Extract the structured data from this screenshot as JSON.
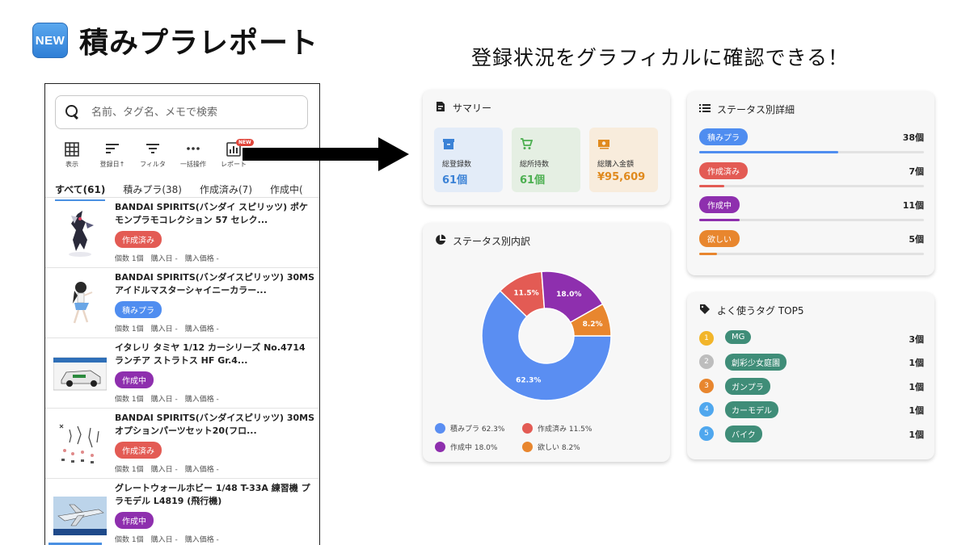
{
  "header": {
    "new_badge": "NEW",
    "title": "積みプラレポート",
    "tagline": "登録状況をグラフィカルに確認できる！"
  },
  "phone": {
    "search_placeholder": "名前、タグ名、メモで検索",
    "toolbar": [
      {
        "label": "表示",
        "icon": "grid-icon"
      },
      {
        "label": "登録日↑",
        "icon": "sort-icon"
      },
      {
        "label": "フィルタ",
        "icon": "filter-icon"
      },
      {
        "label": "一括操作",
        "icon": "more-icon"
      },
      {
        "label": "レポート",
        "icon": "report-icon",
        "badge": "NEW"
      }
    ],
    "tabs": [
      "すべて(61)",
      "積みプラ(38)",
      "作成済み(7)",
      "作成中("
    ],
    "items": [
      {
        "title": "BANDAI SPIRITS(バンダイ スピリッツ) ポケモンプラモコレクション 57 セレク...",
        "status": "作成済み",
        "status_color": "#e35b54",
        "meta": "個数 1個　購入日 -　購入価格 -"
      },
      {
        "title": "BANDAI SPIRITS(バンダイスピリッツ) 30MS アイドルマスターシャイニーカラー...",
        "status": "積みプラ",
        "status_color": "#4f8df0",
        "meta": "個数 1個　購入日 -　購入価格 -"
      },
      {
        "title": "イタレリ タミヤ 1/12 カーシリーズ No.4714 ランチア ストラトス HF Gr.4...",
        "status": "作成中",
        "status_color": "#8e2fae",
        "meta": "個数 1個　購入日 -　購入価格 -"
      },
      {
        "title": "BANDAI SPIRITS(バンダイスピリッツ) 30MS オプションパーツセット20(フロ...",
        "status": "作成済み",
        "status_color": "#e35b54",
        "meta": "個数 1個　購入日 -　購入価格 -"
      },
      {
        "title": "グレートウォールホビー 1/48 T-33A 練習機 プラモデル L4819 (飛行機)",
        "status": "作成中",
        "status_color": "#8e2fae",
        "meta": "個数 1個　購入日 -　購入価格 -"
      }
    ]
  },
  "summary": {
    "title": "サマリー",
    "boxes": [
      {
        "label": "総登録数",
        "value": "61個",
        "bg": "#e3ecf8",
        "color": "#3b82d6",
        "icon": "archive-icon"
      },
      {
        "label": "総所持数",
        "value": "61個",
        "bg": "#e5efe3",
        "color": "#4caf50",
        "icon": "cart-icon"
      },
      {
        "label": "総購入金額",
        "value": "¥95,609",
        "bg": "#f8ecdc",
        "color": "#e08a1e",
        "icon": "money-icon"
      }
    ]
  },
  "breakdown": {
    "title": "ステータス別内訳",
    "chart_data": {
      "type": "pie",
      "categories": [
        "積みプラ",
        "作成済み",
        "作成中",
        "欲しい"
      ],
      "values": [
        62.3,
        11.5,
        18.0,
        8.2
      ],
      "colors": [
        "#5a8ef2",
        "#e35b54",
        "#8e2fae",
        "#e8862e"
      ],
      "slice_labels": [
        "62.3%",
        "11.5%",
        "18.0%",
        "8.2%"
      ],
      "legend": [
        "積みプラ 62.3%",
        "作成済み 11.5%",
        "作成中 18.0%",
        "欲しい 8.2%"
      ]
    }
  },
  "status_detail": {
    "title": "ステータス別詳細",
    "rows": [
      {
        "label": "積みプラ",
        "count": "38個",
        "color": "#4f8df0",
        "fraction": 0.62
      },
      {
        "label": "作成済み",
        "count": "7個",
        "color": "#e35b54",
        "fraction": 0.11
      },
      {
        "label": "作成中",
        "count": "11個",
        "color": "#8e2fae",
        "fraction": 0.18
      },
      {
        "label": "欲しい",
        "count": "5個",
        "color": "#e8862e",
        "fraction": 0.08
      }
    ]
  },
  "top_tags": {
    "title": "よく使うタグ TOP5",
    "rows": [
      {
        "rank": "1",
        "rank_color": "#f2b52a",
        "tag": "MG",
        "count": "3個"
      },
      {
        "rank": "2",
        "rank_color": "#bdbdbd",
        "tag": "創彩少女庭園",
        "count": "1個"
      },
      {
        "rank": "3",
        "rank_color": "#e8862e",
        "tag": "ガンプラ",
        "count": "1個"
      },
      {
        "rank": "4",
        "rank_color": "#4fa7ee",
        "tag": "カーモデル",
        "count": "1個"
      },
      {
        "rank": "5",
        "rank_color": "#4fa7ee",
        "tag": "バイク",
        "count": "1個"
      }
    ]
  }
}
